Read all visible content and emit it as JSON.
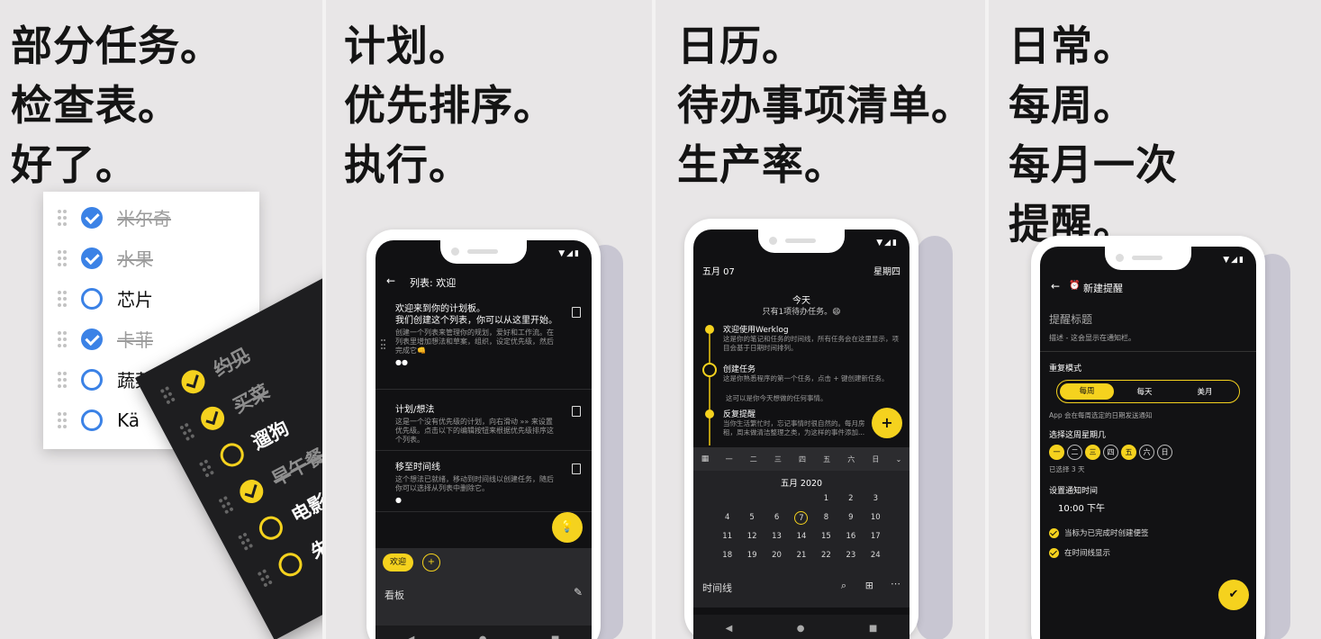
{
  "panel1": {
    "headline": [
      "部分任务。",
      "检查表。",
      "好了。"
    ],
    "checklist": [
      {
        "label": "米尔奇",
        "done": true
      },
      {
        "label": "水果",
        "done": true
      },
      {
        "label": "芯片",
        "done": false
      },
      {
        "label": "卡菲",
        "done": true
      },
      {
        "label": "蔬菜",
        "done": false
      },
      {
        "label": "Kä",
        "done": false
      }
    ],
    "dark_list": [
      {
        "label": "约见",
        "done": true
      },
      {
        "label": "买菜",
        "done": true
      },
      {
        "label": "遛狗",
        "done": false
      },
      {
        "label": "早午餐",
        "done": true
      },
      {
        "label": "电影",
        "done": false
      },
      {
        "label": "朱古",
        "done": false
      }
    ]
  },
  "panel2": {
    "headline": [
      "计划。",
      "优先排序。",
      "执行。"
    ],
    "back_arrow": "←",
    "title": "列表: 欢迎",
    "items": [
      {
        "title": "欢迎来到你的计划板。\n我们创建这个列表，你可以从这里开始。",
        "desc": "创建一个列表来管理你的规划，爱好和工作流。在列表里增加想法和草案，组织，设定优先级，然后完成它👊",
        "dots": "●●"
      },
      {
        "title": "计划/想法",
        "desc": "这是一个没有优先级的计划，向右滑动 »» 来设置优先级。点击以下的编辑按钮来根据优先级排序这个列表。",
        "dots": ""
      },
      {
        "title": "移至时间线",
        "desc": "这个想法已就绪，移动到时间线以创建任务，随后你可以选择从列表中删除它。",
        "dots": "●"
      }
    ],
    "fab": "💡",
    "chips": [
      "欢迎",
      "+"
    ],
    "board_label": "看板",
    "edit_icon": "✎"
  },
  "panel3": {
    "headline": [
      "日历。",
      "待办事项清单。",
      "生产率。"
    ],
    "date": "五月 07",
    "weekday": "星期四",
    "today_title": "今天",
    "today_sub": "只有1项待办任务。😄",
    "timeline": [
      {
        "title": "欢迎使用Werklog",
        "desc": "这是你的笔记和任务的时间线，所有任务会在这里显示，项目会基于日期时间排列。"
      },
      {
        "title": "创建任务",
        "desc": "这是你熟悉程序的第一个任务，点击 + 键创建新任务。"
      },
      {
        "title": "",
        "desc": "这可以是你今天想做的任何事情。"
      },
      {
        "title": "反复提醒",
        "desc": "当你生活繁忙时，忘记事情时很自然的。每月房租，周末做清洁整理之类，为这样的事件添加..."
      }
    ],
    "week_header": [
      "一",
      "二",
      "三",
      "四",
      "五",
      "六",
      "日"
    ],
    "month_title": "五月 2020",
    "days": [
      "",
      "",
      "",
      "",
      "1",
      "2",
      "3",
      "4",
      "5",
      "6",
      "7",
      "8",
      "9",
      "10",
      "11",
      "12",
      "13",
      "14",
      "15",
      "16",
      "17",
      "18",
      "19",
      "20",
      "21",
      "22",
      "23",
      "24"
    ],
    "today_day": "7",
    "fab": "+",
    "bottom_label": "时间线"
  },
  "panel4": {
    "headline": [
      "日常。",
      "每周。",
      "每月一次",
      "提醒。"
    ],
    "title": "新建提醒",
    "reminder_title_placeholder": "提醒标题",
    "reminder_desc_placeholder": "描述 - 这会显示在通知栏。",
    "repeat_label": "重复模式",
    "modes": [
      "每周",
      "每天",
      "美月"
    ],
    "mode_hint": "App 会在每周选定的日期发送通知",
    "pick_days_label": "选择这周星期几",
    "days": [
      {
        "label": "一",
        "on": true
      },
      {
        "label": "二",
        "on": false
      },
      {
        "label": "三",
        "on": true
      },
      {
        "label": "四",
        "on": false
      },
      {
        "label": "五",
        "on": true
      },
      {
        "label": "六",
        "on": false
      },
      {
        "label": "日",
        "on": false
      }
    ],
    "selected_count": "已选择 3 天",
    "time_label": "设置通知时间",
    "time_value": "10:00 下午",
    "option1": "当标为已完成时创建便签",
    "option2": "在时间线显示",
    "fab": "✔"
  },
  "nav": {
    "back": "◀",
    "home": "●",
    "recent": "■"
  },
  "status_icons": "▼◢▮"
}
